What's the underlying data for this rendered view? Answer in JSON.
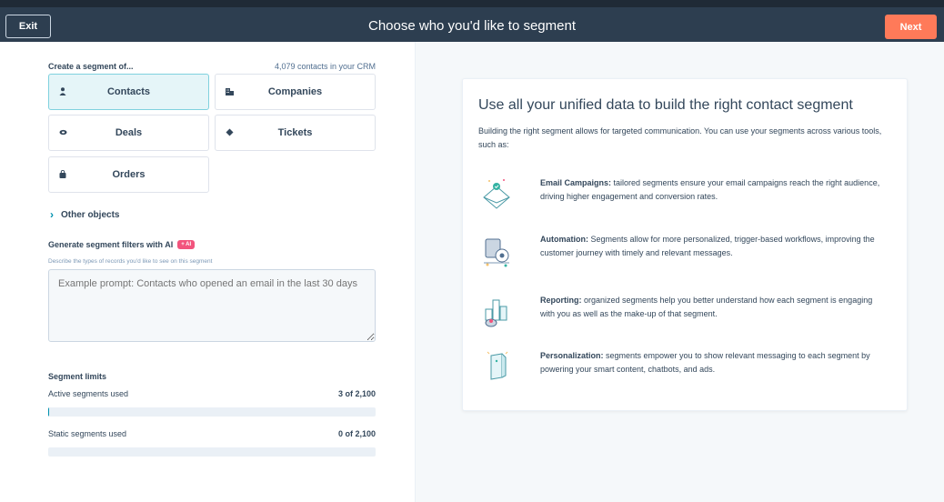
{
  "header": {
    "exit_label": "Exit",
    "title": "Choose who you'd like to segment",
    "next_label": "Next"
  },
  "segment": {
    "create_label": "Create a segment of...",
    "contacts_count": "4,079 contacts in your CRM",
    "objects": [
      {
        "label": "Contacts",
        "icon": "person-icon",
        "selected": true
      },
      {
        "label": "Companies",
        "icon": "building-icon",
        "selected": false
      },
      {
        "label": "Deals",
        "icon": "handshake-icon",
        "selected": false
      },
      {
        "label": "Tickets",
        "icon": "ticket-icon",
        "selected": false
      },
      {
        "label": "Orders",
        "icon": "bag-icon",
        "selected": false
      }
    ],
    "other_objects": "Other objects"
  },
  "ai": {
    "heading": "Generate segment filters with AI",
    "badge": "+ AI",
    "subtext": "Describe the types of records you'd like to see on this segment",
    "placeholder": "Example prompt: Contacts who opened an email in the last 30 days"
  },
  "limits": {
    "title": "Segment limits",
    "active_label": "Active segments used",
    "active_value": "3 of 2,100",
    "active_fraction": 0.0014,
    "static_label": "Static segments used",
    "static_value": "0 of 2,100",
    "static_fraction": 0
  },
  "info": {
    "heading": "Use all your unified data to build the right contact segment",
    "intro": "Building the right segment allows for targeted communication. You can use your segments across various tools, such as:",
    "features": [
      {
        "title": "Email Campaigns:",
        "text": " tailored segments ensure your email campaigns reach the right audience, driving higher engagement and conversion rates.",
        "icon": "email-campaign-icon"
      },
      {
        "title": "Automation:",
        "text": " Segments allow for more personalized, trigger-based workflows, improving the customer journey with timely and relevant messages.",
        "icon": "automation-icon"
      },
      {
        "title": "Reporting:",
        "text": " organized segments help you better understand how each segment is engaging with you as well as the make-up of that segment.",
        "icon": "reporting-icon"
      },
      {
        "title": "Personalization:",
        "text": " segments empower you to show relevant messaging to each segment by powering your smart content, chatbots, and ads.",
        "icon": "personalization-icon"
      }
    ]
  },
  "colors": {
    "header_bg": "#2d3e50",
    "accent": "#ff7a59",
    "selected_bg": "#e5f5f8",
    "ai_badge": "#f2547d"
  }
}
